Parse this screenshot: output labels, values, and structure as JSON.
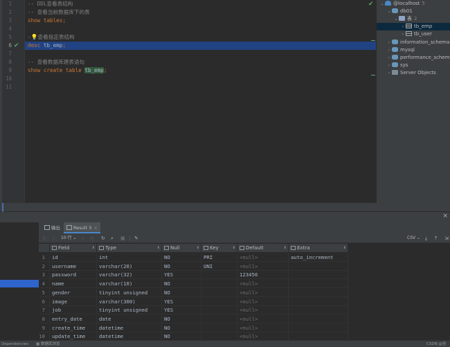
{
  "editor": {
    "lines": [
      {
        "num": "1",
        "tokens": [
          {
            "t": "-- DDL查看表结构",
            "c": "c-comment"
          }
        ]
      },
      {
        "num": "2",
        "tokens": [
          {
            "t": "-- 查看当前数据库下的表",
            "c": "c-comment"
          }
        ]
      },
      {
        "num": "3",
        "tokens": [
          {
            "t": "show",
            "c": "c-kw"
          },
          {
            "t": " ",
            "c": "c-ident"
          },
          {
            "t": "tables",
            "c": "c-kw"
          },
          {
            "t": ";",
            "c": "c-kw"
          }
        ]
      },
      {
        "num": "4",
        "tokens": []
      },
      {
        "num": "5",
        "tokens": [
          {
            "t": "-",
            "c": "c-comment"
          },
          {
            "t": "💡",
            "c": "bulb"
          },
          {
            "t": "查看指定表结构",
            "c": "c-comment"
          }
        ]
      },
      {
        "num": "6",
        "tokens": [
          {
            "t": "desc",
            "c": "c-kw"
          },
          {
            "t": " tb_emp",
            "c": "c-tbl"
          },
          {
            "t": ";",
            "c": "c-kw"
          }
        ],
        "selected": true,
        "check": true
      },
      {
        "num": "7",
        "tokens": []
      },
      {
        "num": "8",
        "tokens": [
          {
            "t": "-- 查看数据库建表语句",
            "c": "c-comment"
          }
        ]
      },
      {
        "num": "9",
        "tokens": [
          {
            "t": "show create table ",
            "c": "c-kw"
          },
          {
            "t": "tb_emp",
            "c": "c-hl"
          },
          {
            "t": ";",
            "c": "c-kw"
          }
        ]
      },
      {
        "num": "10",
        "tokens": []
      },
      {
        "num": "11",
        "tokens": []
      }
    ]
  },
  "tree": {
    "items": [
      {
        "label": "@localhost",
        "count": "5",
        "icon": "host-icon",
        "arrow": "⌄",
        "indent": 4
      },
      {
        "label": "db01",
        "count": "",
        "icon": "database-icon",
        "arrow": "⌄",
        "indent": 14
      },
      {
        "label": "表",
        "count": "2",
        "icon": "folder-icon",
        "arrow": "⌄",
        "indent": 24
      },
      {
        "label": "tb_emp",
        "count": "",
        "icon": "table-icon",
        "arrow": "›",
        "indent": 34,
        "selected": true
      },
      {
        "label": "tb_user",
        "count": "",
        "icon": "table-icon",
        "arrow": "›",
        "indent": 34
      },
      {
        "label": "information_schema",
        "count": "",
        "icon": "database-icon",
        "arrow": "›",
        "indent": 14
      },
      {
        "label": "mysql",
        "count": "",
        "icon": "database-icon",
        "arrow": "›",
        "indent": 14
      },
      {
        "label": "performance_schema",
        "count": "",
        "icon": "database-icon",
        "arrow": "›",
        "indent": 14
      },
      {
        "label": "sys",
        "count": "",
        "icon": "database-icon",
        "arrow": "›",
        "indent": 14
      },
      {
        "label": "Server Objects",
        "count": "",
        "icon": "server-objects-icon",
        "arrow": "›",
        "indent": 14
      }
    ]
  },
  "results": {
    "tabs": [
      {
        "label": "输出",
        "active": false
      },
      {
        "label": "Result 3",
        "active": true,
        "close": "×"
      }
    ],
    "toolbar": {
      "rows": "10 行",
      "export_format": "CSV"
    },
    "columns": [
      "Field",
      "Type",
      "Null",
      "Key",
      "Default",
      "Extra"
    ],
    "rows": [
      [
        "1",
        "id",
        "int",
        "NO",
        "PRI",
        "<null>",
        "auto_increment"
      ],
      [
        "2",
        "username",
        "varchar(20)",
        "NO",
        "UNI",
        "<null>",
        ""
      ],
      [
        "3",
        "password",
        "varchar(32)",
        "YES",
        "",
        "123456",
        ""
      ],
      [
        "4",
        "name",
        "varchar(10)",
        "NO",
        "",
        "<null>",
        ""
      ],
      [
        "5",
        "gender",
        "tinyint unsigned",
        "NO",
        "",
        "<null>",
        ""
      ],
      [
        "6",
        "image",
        "varchar(300)",
        "YES",
        "",
        "<null>",
        ""
      ],
      [
        "7",
        "job",
        "tinyint unsigned",
        "YES",
        "",
        "<null>",
        ""
      ],
      [
        "8",
        "entry_date",
        "date",
        "NO",
        "",
        "<null>",
        ""
      ],
      [
        "9",
        "create_time",
        "datetime",
        "NO",
        "",
        "<null>",
        ""
      ],
      [
        "10",
        "update_time",
        "datetime",
        "NO",
        "",
        "<null>",
        ""
      ]
    ]
  },
  "status": {
    "left1": "Dependencies",
    "left2": "数据库浏览",
    "right": "CSDN @佳Ming"
  },
  "colors": {
    "background": "#2b2b2b",
    "selection": "#214283",
    "keyword": "#cc7832",
    "comment": "#808080",
    "success": "#59a869"
  }
}
